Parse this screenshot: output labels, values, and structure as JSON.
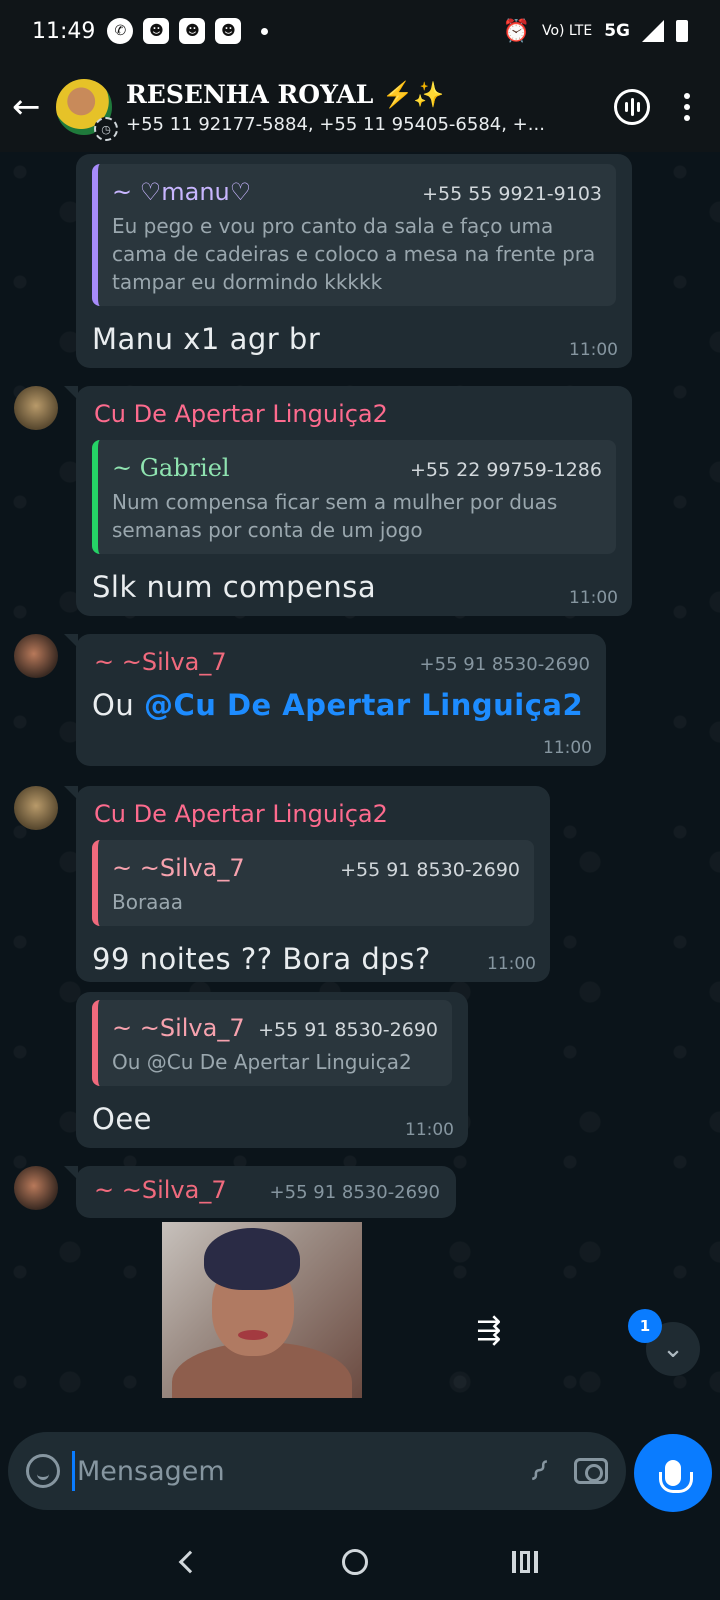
{
  "status_bar": {
    "time": "11:49",
    "network": "5G",
    "volte": "Vo) LTE"
  },
  "header": {
    "title": "RESENHA ROYAL ⚡✨",
    "subtitle": "+55 11 92177-5884, +55 11 95405-6584, +..."
  },
  "messages": [
    {
      "quote_name": "~ ♡manu♡",
      "quote_phone": "+55 55 9921-9103",
      "quote_text": "Eu pego e vou pro canto da sala e faço uma cama de cadeiras e coloco a mesa na frente pra tampar eu dormindo kkkkk",
      "text": "Manu x1 agr br",
      "time": "11:00"
    },
    {
      "sender": "Cu De Apertar Linguiça2",
      "quote_name": "~ Gabriel",
      "quote_phone": "+55 22 99759-1286",
      "quote_text": "Num compensa ficar sem a mulher por duas semanas por conta de um jogo",
      "text": "Slk num  compensa",
      "time": "11:00"
    },
    {
      "sender": "~ ~Silva_7",
      "sender_phone": "+55 91 8530-2690",
      "text_prefix": "Ou ",
      "mention": "@Cu De Apertar Linguiça2",
      "time": "11:00"
    },
    {
      "sender": "Cu De Apertar Linguiça2",
      "quote_name": "~ ~Silva_7",
      "quote_phone": "+55 91 8530-2690",
      "quote_text": "Boraaa",
      "text": "99 noites ?? Bora dps?",
      "time": "11:00"
    },
    {
      "quote_name": "~ ~Silva_7",
      "quote_phone": "+55 91 8530-2690",
      "quote_text": "Ou @Cu De Apertar Linguiça2",
      "text": "Oee",
      "time": "11:00"
    },
    {
      "sender": "~ ~Silva_7",
      "sender_phone": "+55 91 8530-2690"
    }
  ],
  "unread_count": "1",
  "composer": {
    "placeholder": "Mensagem"
  },
  "colors": {
    "accent": "#0a7cff",
    "quote_manu": "#a78bfa",
    "quote_gabriel": "#25d366",
    "quote_silva": "#f06a7d"
  }
}
